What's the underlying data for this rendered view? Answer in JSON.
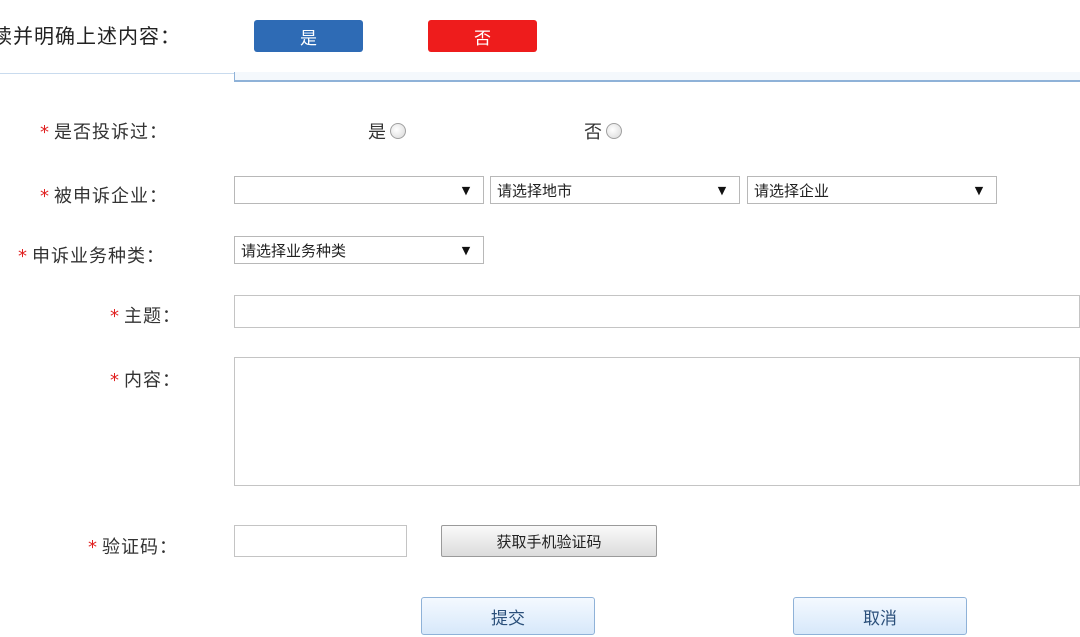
{
  "confirm": {
    "text": "读并明确上述内容：",
    "yes_label": "是",
    "no_label": "否"
  },
  "form": {
    "complained_before": {
      "label": "是否投诉过：",
      "options": [
        "是",
        "否"
      ]
    },
    "enterprise": {
      "label": "被申诉企业：",
      "select1_value": "",
      "select2_value": "请选择地市",
      "select3_value": "请选择企业"
    },
    "business_type": {
      "label": "申诉业务种类：",
      "select_value": "请选择业务种类"
    },
    "subject": {
      "label": "主题：",
      "value": ""
    },
    "content": {
      "label": "内容：",
      "value": ""
    },
    "captcha": {
      "label": "验证码：",
      "value": "",
      "button_label": "获取手机验证码"
    }
  },
  "actions": {
    "submit_label": "提交",
    "cancel_label": "取消"
  },
  "required_mark": "*",
  "dropdown_glyph": "▼",
  "colors": {
    "yes_button": "#2e6bb5",
    "no_button": "#ee1c1c",
    "required_star": "#e02020"
  }
}
